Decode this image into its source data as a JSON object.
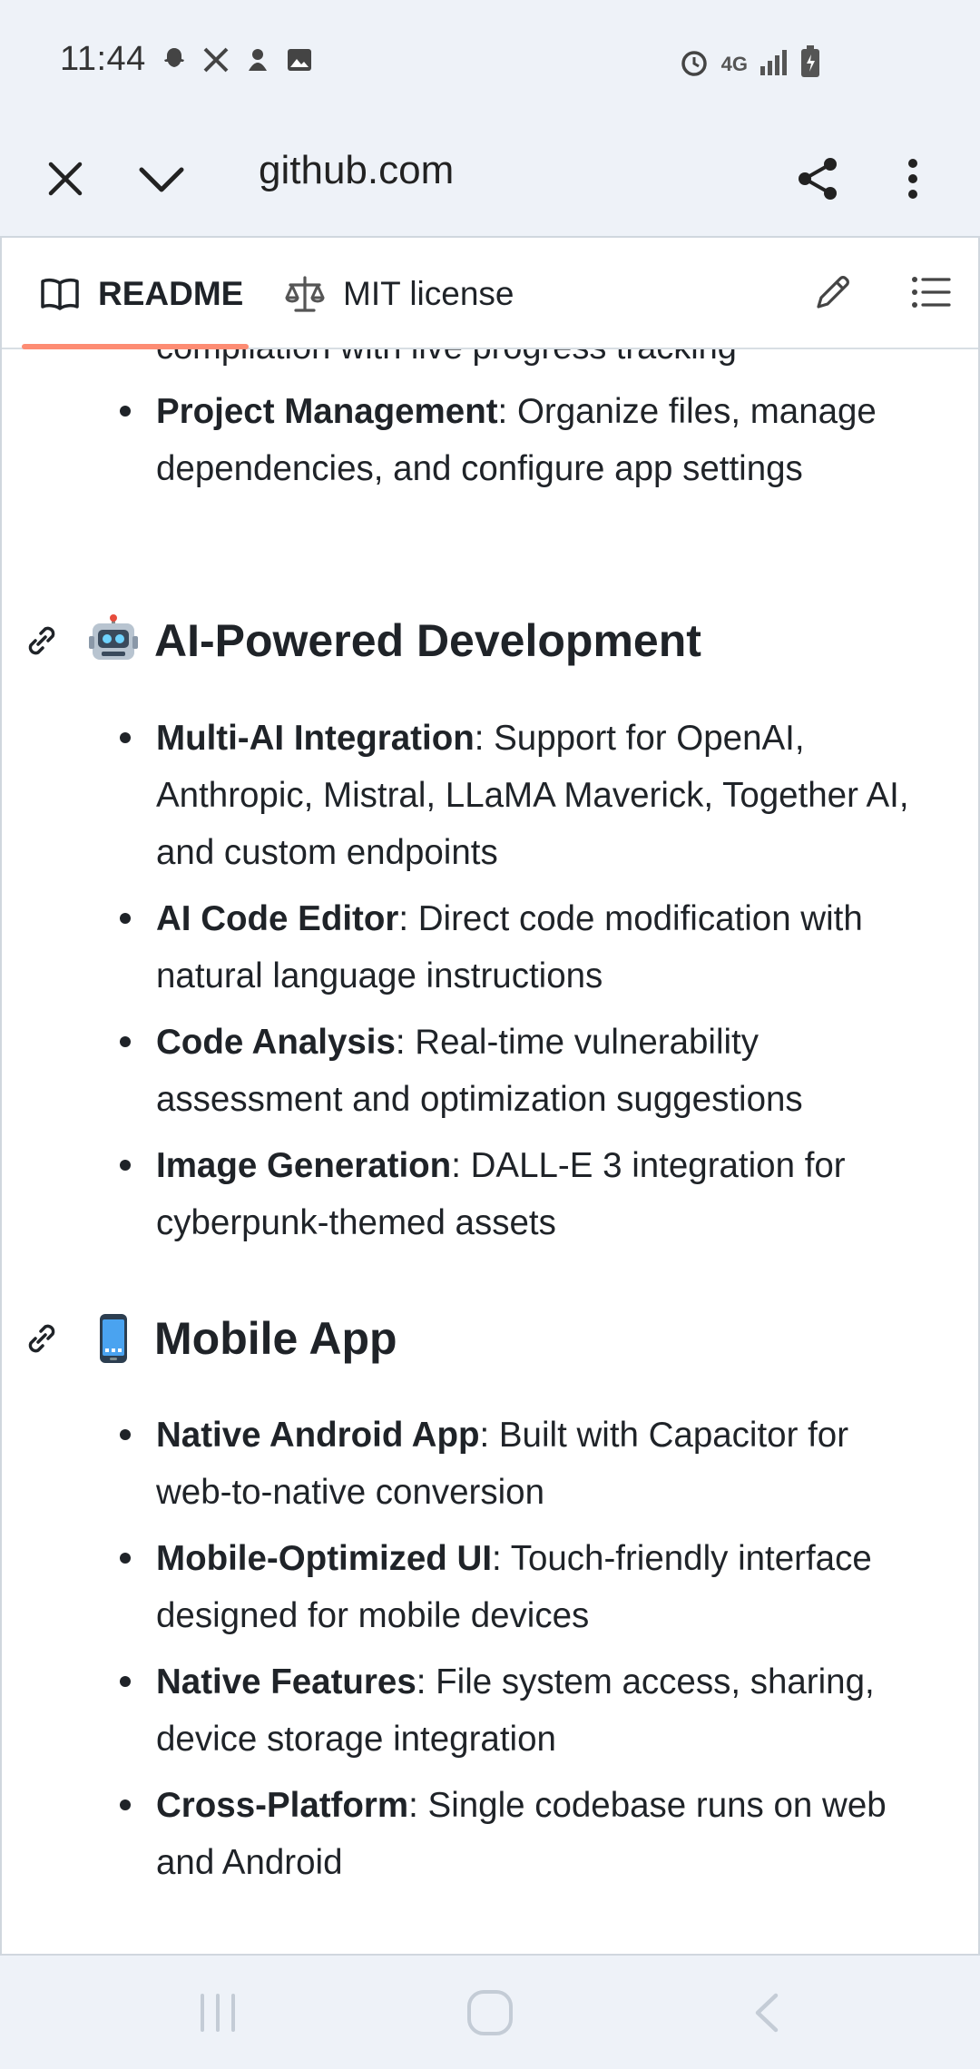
{
  "status_bar": {
    "time": "11:44",
    "left_icons": [
      "snapchat-icon",
      "x-icon",
      "app-icon",
      "gallery-icon"
    ],
    "right_icons": [
      "alarm-icon",
      "4g-icon",
      "signal-icon",
      "battery-icon"
    ],
    "network_label": "4G"
  },
  "browser": {
    "url": "github.com"
  },
  "tabs": {
    "readme": "README",
    "license": "MIT license"
  },
  "readme": {
    "cut_line": "compilation with live progress tracking",
    "top_items": [
      {
        "bold": "Project Management",
        "text": ": Organize files, manage dependencies, and configure app settings"
      }
    ],
    "sections": [
      {
        "title": "AI-Powered Development",
        "emoji": "robot-emoji",
        "items": [
          {
            "bold": "Multi-AI Integration",
            "text": ": Support for OpenAI, Anthropic, Mistral, LLaMA Maverick, Together AI, and custom endpoints"
          },
          {
            "bold": "AI Code Editor",
            "text": ": Direct code modification with natural language instructions"
          },
          {
            "bold": "Code Analysis",
            "text": ": Real-time vulnerability assessment and optimization suggestions"
          },
          {
            "bold": "Image Generation",
            "text": ": DALL-E 3 integration for cyberpunk-themed assets"
          }
        ]
      },
      {
        "title": "Mobile App",
        "emoji": "mobile-phone-emoji",
        "items": [
          {
            "bold": "Native Android App",
            "text": ": Built with Capacitor for web-to-native conversion"
          },
          {
            "bold": "Mobile-Optimized UI",
            "text": ": Touch-friendly interface designed for mobile devices"
          },
          {
            "bold": "Native Features",
            "text": ": File system access, sharing, device storage integration"
          },
          {
            "bold": "Cross-Platform",
            "text": ": Single codebase runs on web and Android"
          }
        ]
      }
    ]
  },
  "colors": {
    "tab_underline": "#fd8c73",
    "text": "#1f2328",
    "chrome_bg": "#eef2f8"
  }
}
